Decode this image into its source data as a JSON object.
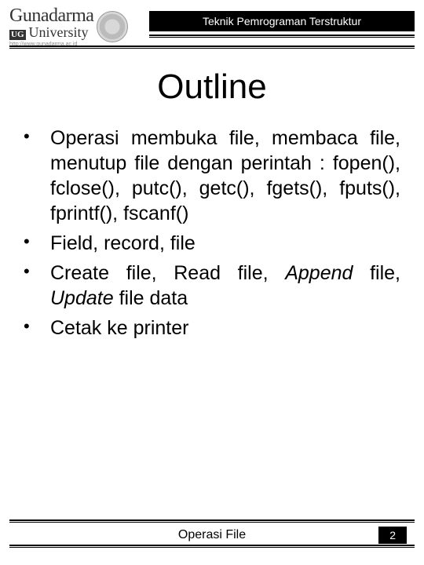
{
  "header": {
    "logo_main": "Gunadarma",
    "logo_sub": "University",
    "logo_uc": "UG",
    "logo_url": "http://www.gunadarma.ac.id",
    "course_title": "Teknik Pemrograman Terstruktur"
  },
  "slide": {
    "title": "Outline",
    "bullets": [
      {
        "text": "Operasi membuka file, membaca file, menutup file dengan perintah : fopen(), fclose(), putc(), getc(), fgets(), fputs(), fprintf(), fscanf()"
      },
      {
        "text": "Field, record, file"
      },
      {
        "html": "Create file, Read file, <span class=\"i\">Append</span> file, <span class=\"i\">Update</span> file data"
      },
      {
        "text": "Cetak ke printer"
      }
    ]
  },
  "footer": {
    "title": "Operasi File",
    "page": "2"
  }
}
